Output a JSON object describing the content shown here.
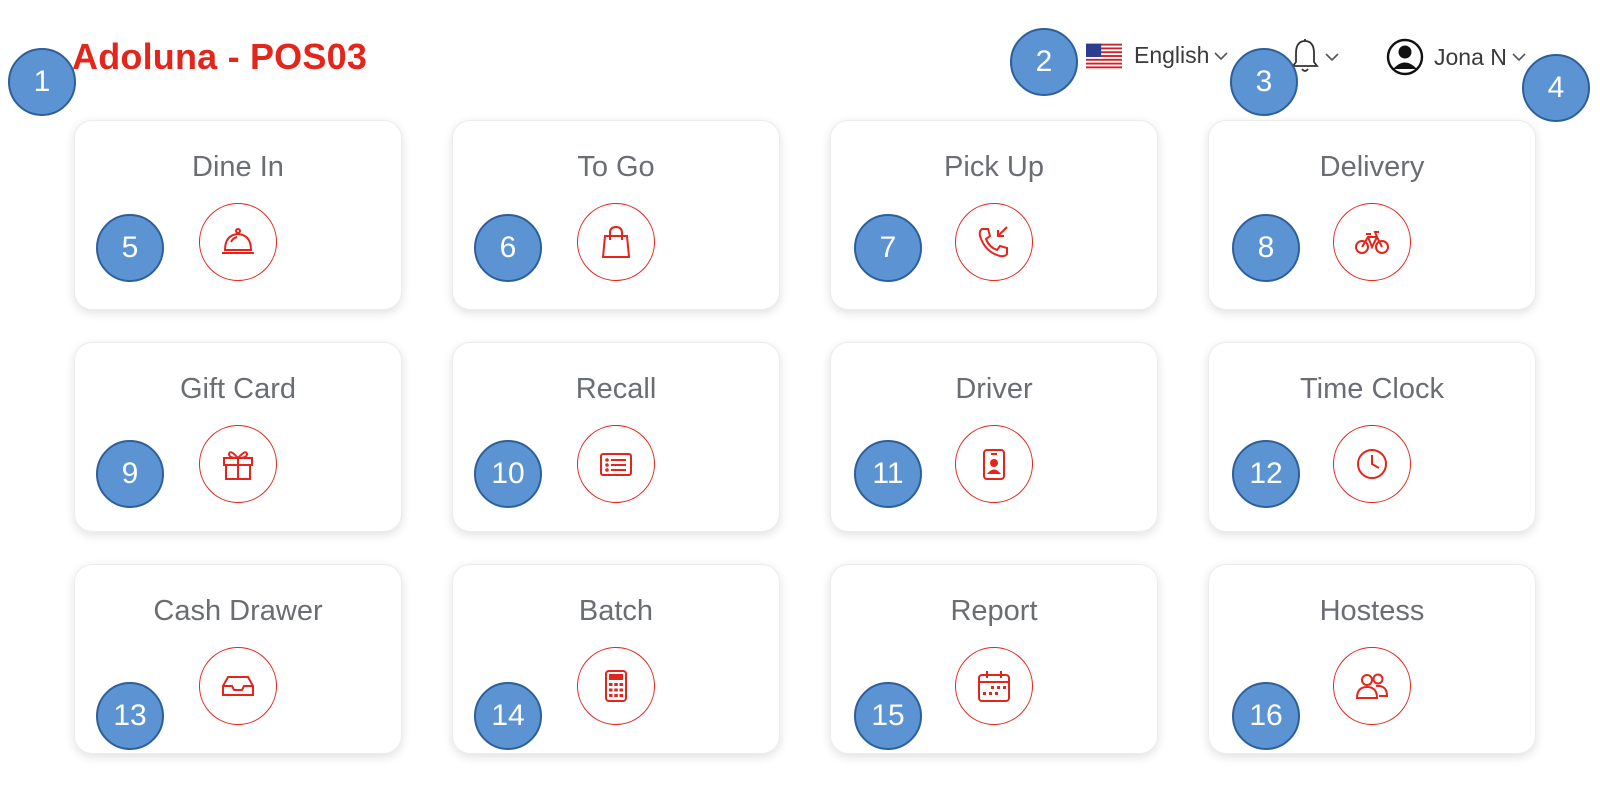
{
  "header": {
    "app_title": "Adoluna - POS03",
    "language": {
      "label": "English",
      "flag": "us-flag-icon"
    },
    "notifications": {
      "icon": "bell-icon"
    },
    "user": {
      "name": "Jona N",
      "icon": "user-circle-icon"
    }
  },
  "tiles": [
    {
      "label": "Dine In",
      "icon": "serving-cloche-icon"
    },
    {
      "label": "To Go",
      "icon": "shopping-bag-icon"
    },
    {
      "label": "Pick Up",
      "icon": "incoming-call-icon"
    },
    {
      "label": "Delivery",
      "icon": "bicycle-icon"
    },
    {
      "label": "Gift Card",
      "icon": "gift-icon"
    },
    {
      "label": "Recall",
      "icon": "receipt-list-icon"
    },
    {
      "label": "Driver",
      "icon": "id-badge-icon"
    },
    {
      "label": "Time Clock",
      "icon": "clock-icon"
    },
    {
      "label": "Cash Drawer",
      "icon": "drawer-tray-icon"
    },
    {
      "label": "Batch",
      "icon": "calculator-icon"
    },
    {
      "label": "Report",
      "icon": "calendar-icon"
    },
    {
      "label": "Hostess",
      "icon": "people-icon"
    }
  ],
  "markers": [
    "1",
    "2",
    "3",
    "4",
    "5",
    "6",
    "7",
    "8",
    "9",
    "10",
    "11",
    "12",
    "13",
    "14",
    "15",
    "16"
  ],
  "colors": {
    "brand_red": "#e4251b",
    "marker_blue": "#5b93d3",
    "tile_text": "#6a6e73"
  }
}
